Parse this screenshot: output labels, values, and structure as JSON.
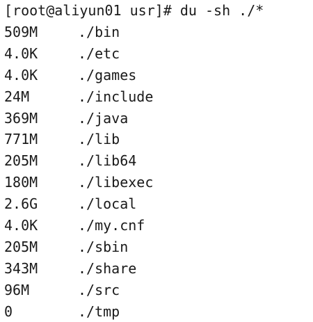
{
  "terminal": {
    "prompt": "[root@aliyun01 usr]# du -sh ./*",
    "rows": [
      {
        "size": "509M",
        "path": "./bin"
      },
      {
        "size": "4.0K",
        "path": "./etc"
      },
      {
        "size": "4.0K",
        "path": "./games"
      },
      {
        "size": "24M",
        "path": "./include"
      },
      {
        "size": "369M",
        "path": "./java"
      },
      {
        "size": "771M",
        "path": "./lib"
      },
      {
        "size": "205M",
        "path": "./lib64"
      },
      {
        "size": "180M",
        "path": "./libexec"
      },
      {
        "size": "2.6G",
        "path": "./local"
      },
      {
        "size": "4.0K",
        "path": "./my.cnf"
      },
      {
        "size": "205M",
        "path": "./sbin"
      },
      {
        "size": "343M",
        "path": "./share"
      },
      {
        "size": "96M",
        "path": "./src"
      },
      {
        "size": "0",
        "path": "./tmp"
      }
    ]
  }
}
